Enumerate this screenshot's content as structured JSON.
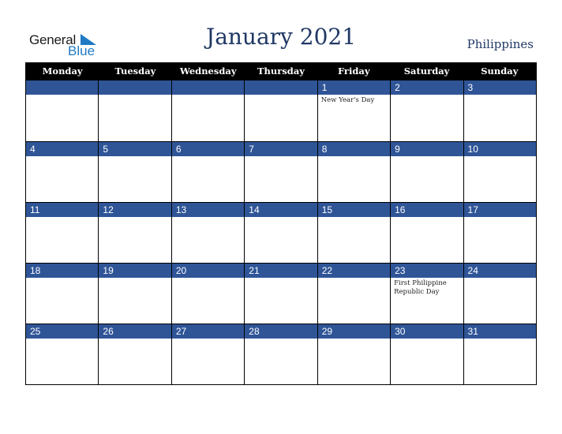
{
  "logo": {
    "line1": "General",
    "line2": "Blue"
  },
  "title": "January 2021",
  "country": "Philippines",
  "weekdays": [
    "Monday",
    "Tuesday",
    "Wednesday",
    "Thursday",
    "Friday",
    "Saturday",
    "Sunday"
  ],
  "weeks": [
    [
      {
        "day": "",
        "event": ""
      },
      {
        "day": "",
        "event": ""
      },
      {
        "day": "",
        "event": ""
      },
      {
        "day": "",
        "event": ""
      },
      {
        "day": "1",
        "event": "New Year's Day"
      },
      {
        "day": "2",
        "event": ""
      },
      {
        "day": "3",
        "event": ""
      }
    ],
    [
      {
        "day": "4",
        "event": ""
      },
      {
        "day": "5",
        "event": ""
      },
      {
        "day": "6",
        "event": ""
      },
      {
        "day": "7",
        "event": ""
      },
      {
        "day": "8",
        "event": ""
      },
      {
        "day": "9",
        "event": ""
      },
      {
        "day": "10",
        "event": ""
      }
    ],
    [
      {
        "day": "11",
        "event": ""
      },
      {
        "day": "12",
        "event": ""
      },
      {
        "day": "13",
        "event": ""
      },
      {
        "day": "14",
        "event": ""
      },
      {
        "day": "15",
        "event": ""
      },
      {
        "day": "16",
        "event": ""
      },
      {
        "day": "17",
        "event": ""
      }
    ],
    [
      {
        "day": "18",
        "event": ""
      },
      {
        "day": "19",
        "event": ""
      },
      {
        "day": "20",
        "event": ""
      },
      {
        "day": "21",
        "event": ""
      },
      {
        "day": "22",
        "event": ""
      },
      {
        "day": "23",
        "event": "First Philippine Republic Day"
      },
      {
        "day": "24",
        "event": ""
      }
    ],
    [
      {
        "day": "25",
        "event": ""
      },
      {
        "day": "26",
        "event": ""
      },
      {
        "day": "27",
        "event": ""
      },
      {
        "day": "28",
        "event": ""
      },
      {
        "day": "29",
        "event": ""
      },
      {
        "day": "30",
        "event": ""
      },
      {
        "day": "31",
        "event": ""
      }
    ]
  ],
  "colors": {
    "header_bg": "#000000",
    "daybar_bg": "#2f5597",
    "title": "#1f3864",
    "logo_blue": "#1f7ac4"
  }
}
